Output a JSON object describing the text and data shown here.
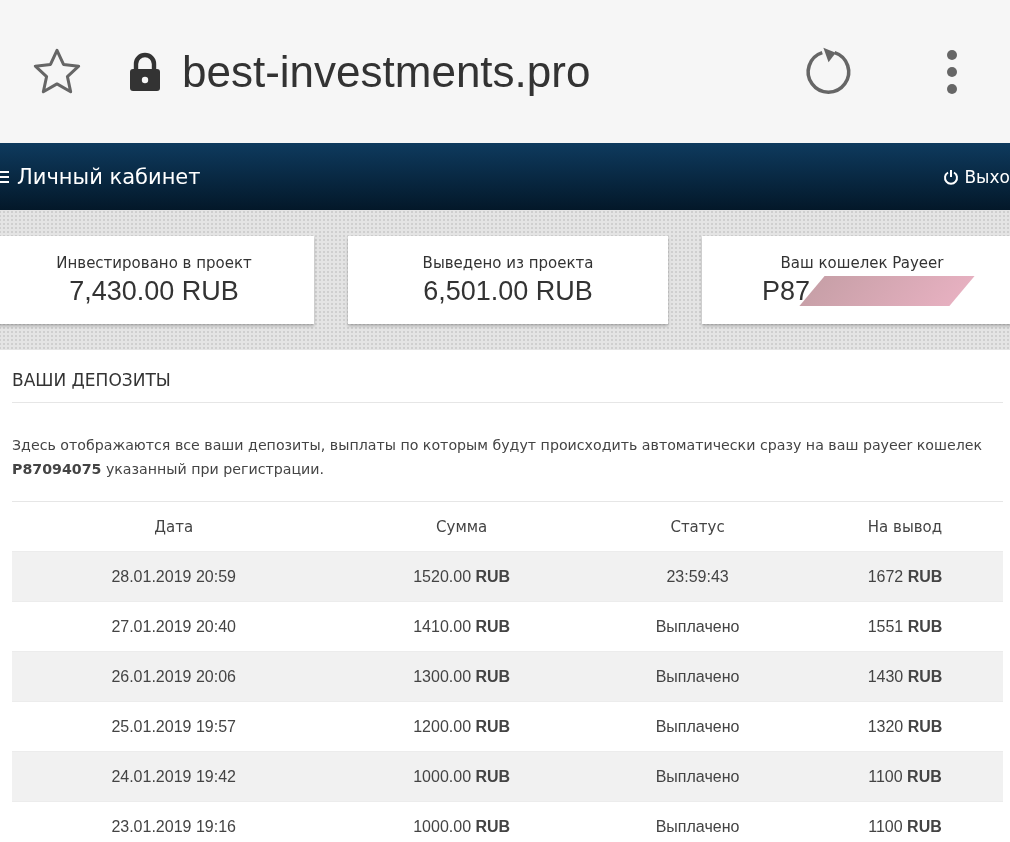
{
  "browser": {
    "url": "best-investments.pro"
  },
  "header": {
    "title": "Личный кабинет",
    "logout": "Выхо"
  },
  "cards": [
    {
      "kind": "value",
      "label": "Инвестировано в проект",
      "value": "7,430.00 RUB"
    },
    {
      "kind": "value",
      "label": "Выведено из проекта",
      "value": "6,501.00 RUB"
    },
    {
      "kind": "redacted",
      "label": "Ваш кошелек Payeer",
      "value": "P87"
    }
  ],
  "deposits": {
    "title": "ВАШИ ДЕПОЗИТЫ",
    "description": "Здесь отображаются все ваши депозиты, выплаты по которым будут происходить автоматически сразу на ваш payeer кошелек **P87094075** указанный при регистрации.",
    "columns": [
      "Дата",
      "Сумма",
      "Статус",
      "На вывод"
    ],
    "rows": [
      [
        "28.01.2019 20:59",
        "1520.00 **RUB**",
        "23:59:43",
        "1672 **RUB**"
      ],
      [
        "27.01.2019 20:40",
        "1410.00 **RUB**",
        "Выплачено",
        "1551 **RUB**"
      ],
      [
        "26.01.2019 20:06",
        "1300.00 **RUB**",
        "Выплачено",
        "1430 **RUB**"
      ],
      [
        "25.01.2019 19:57",
        "1200.00 **RUB**",
        "Выплачено",
        "1320 **RUB**"
      ],
      [
        "24.01.2019 19:42",
        "1000.00 **RUB**",
        "Выплачено",
        "1100 **RUB**"
      ],
      [
        "23.01.2019 19:16",
        "1000.00 **RUB**",
        "Выплачено",
        "1100 **RUB**"
      ]
    ]
  }
}
